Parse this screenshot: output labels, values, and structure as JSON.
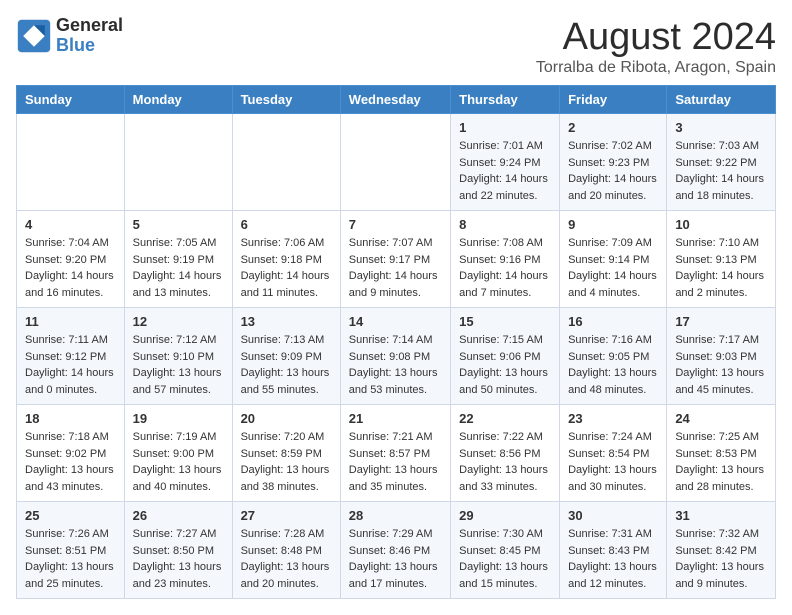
{
  "logo": {
    "line1": "General",
    "line2": "Blue"
  },
  "title": "August 2024",
  "location": "Torralba de Ribota, Aragon, Spain",
  "days_of_week": [
    "Sunday",
    "Monday",
    "Tuesday",
    "Wednesday",
    "Thursday",
    "Friday",
    "Saturday"
  ],
  "weeks": [
    [
      {
        "day": "",
        "info": ""
      },
      {
        "day": "",
        "info": ""
      },
      {
        "day": "",
        "info": ""
      },
      {
        "day": "",
        "info": ""
      },
      {
        "day": "1",
        "info": "Sunrise: 7:01 AM\nSunset: 9:24 PM\nDaylight: 14 hours and 22 minutes."
      },
      {
        "day": "2",
        "info": "Sunrise: 7:02 AM\nSunset: 9:23 PM\nDaylight: 14 hours and 20 minutes."
      },
      {
        "day": "3",
        "info": "Sunrise: 7:03 AM\nSunset: 9:22 PM\nDaylight: 14 hours and 18 minutes."
      }
    ],
    [
      {
        "day": "4",
        "info": "Sunrise: 7:04 AM\nSunset: 9:20 PM\nDaylight: 14 hours and 16 minutes."
      },
      {
        "day": "5",
        "info": "Sunrise: 7:05 AM\nSunset: 9:19 PM\nDaylight: 14 hours and 13 minutes."
      },
      {
        "day": "6",
        "info": "Sunrise: 7:06 AM\nSunset: 9:18 PM\nDaylight: 14 hours and 11 minutes."
      },
      {
        "day": "7",
        "info": "Sunrise: 7:07 AM\nSunset: 9:17 PM\nDaylight: 14 hours and 9 minutes."
      },
      {
        "day": "8",
        "info": "Sunrise: 7:08 AM\nSunset: 9:16 PM\nDaylight: 14 hours and 7 minutes."
      },
      {
        "day": "9",
        "info": "Sunrise: 7:09 AM\nSunset: 9:14 PM\nDaylight: 14 hours and 4 minutes."
      },
      {
        "day": "10",
        "info": "Sunrise: 7:10 AM\nSunset: 9:13 PM\nDaylight: 14 hours and 2 minutes."
      }
    ],
    [
      {
        "day": "11",
        "info": "Sunrise: 7:11 AM\nSunset: 9:12 PM\nDaylight: 14 hours and 0 minutes."
      },
      {
        "day": "12",
        "info": "Sunrise: 7:12 AM\nSunset: 9:10 PM\nDaylight: 13 hours and 57 minutes."
      },
      {
        "day": "13",
        "info": "Sunrise: 7:13 AM\nSunset: 9:09 PM\nDaylight: 13 hours and 55 minutes."
      },
      {
        "day": "14",
        "info": "Sunrise: 7:14 AM\nSunset: 9:08 PM\nDaylight: 13 hours and 53 minutes."
      },
      {
        "day": "15",
        "info": "Sunrise: 7:15 AM\nSunset: 9:06 PM\nDaylight: 13 hours and 50 minutes."
      },
      {
        "day": "16",
        "info": "Sunrise: 7:16 AM\nSunset: 9:05 PM\nDaylight: 13 hours and 48 minutes."
      },
      {
        "day": "17",
        "info": "Sunrise: 7:17 AM\nSunset: 9:03 PM\nDaylight: 13 hours and 45 minutes."
      }
    ],
    [
      {
        "day": "18",
        "info": "Sunrise: 7:18 AM\nSunset: 9:02 PM\nDaylight: 13 hours and 43 minutes."
      },
      {
        "day": "19",
        "info": "Sunrise: 7:19 AM\nSunset: 9:00 PM\nDaylight: 13 hours and 40 minutes."
      },
      {
        "day": "20",
        "info": "Sunrise: 7:20 AM\nSunset: 8:59 PM\nDaylight: 13 hours and 38 minutes."
      },
      {
        "day": "21",
        "info": "Sunrise: 7:21 AM\nSunset: 8:57 PM\nDaylight: 13 hours and 35 minutes."
      },
      {
        "day": "22",
        "info": "Sunrise: 7:22 AM\nSunset: 8:56 PM\nDaylight: 13 hours and 33 minutes."
      },
      {
        "day": "23",
        "info": "Sunrise: 7:24 AM\nSunset: 8:54 PM\nDaylight: 13 hours and 30 minutes."
      },
      {
        "day": "24",
        "info": "Sunrise: 7:25 AM\nSunset: 8:53 PM\nDaylight: 13 hours and 28 minutes."
      }
    ],
    [
      {
        "day": "25",
        "info": "Sunrise: 7:26 AM\nSunset: 8:51 PM\nDaylight: 13 hours and 25 minutes."
      },
      {
        "day": "26",
        "info": "Sunrise: 7:27 AM\nSunset: 8:50 PM\nDaylight: 13 hours and 23 minutes."
      },
      {
        "day": "27",
        "info": "Sunrise: 7:28 AM\nSunset: 8:48 PM\nDaylight: 13 hours and 20 minutes."
      },
      {
        "day": "28",
        "info": "Sunrise: 7:29 AM\nSunset: 8:46 PM\nDaylight: 13 hours and 17 minutes."
      },
      {
        "day": "29",
        "info": "Sunrise: 7:30 AM\nSunset: 8:45 PM\nDaylight: 13 hours and 15 minutes."
      },
      {
        "day": "30",
        "info": "Sunrise: 7:31 AM\nSunset: 8:43 PM\nDaylight: 13 hours and 12 minutes."
      },
      {
        "day": "31",
        "info": "Sunrise: 7:32 AM\nSunset: 8:42 PM\nDaylight: 13 hours and 9 minutes."
      }
    ]
  ]
}
